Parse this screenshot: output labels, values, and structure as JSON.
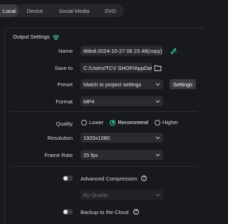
{
  "tabs": [
    {
      "label": "Local",
      "active": true
    },
    {
      "label": "Device",
      "active": false
    },
    {
      "label": "Social Media",
      "active": false
    },
    {
      "label": "DVD",
      "active": false
    }
  ],
  "section": {
    "title": "Output Settings",
    "icon": "crown-icon"
  },
  "form": {
    "name": {
      "label": "Name",
      "value": "ititled-2024-10-27 06 23 48(copy)"
    },
    "save_to": {
      "label": "Save to",
      "value": "C:/Users/TCV SHOP/AppData/"
    },
    "preset": {
      "label": "Preset",
      "value": "Match to project settings",
      "button": "Settings"
    },
    "format": {
      "label": "Format",
      "value": "MP4"
    },
    "quality": {
      "label": "Quality",
      "options": [
        "Lower",
        "Recommend",
        "Higher"
      ],
      "selected": "Recommend"
    },
    "resolution": {
      "label": "Resolution",
      "value": "1920x1080"
    },
    "frame_rate": {
      "label": "Frame Rate",
      "value": "25 fps"
    }
  },
  "advanced": {
    "label": "Advanced Compression",
    "enabled": false,
    "mode": "By Quality"
  },
  "cloud": {
    "label": "Backup to the Cloud",
    "enabled": false
  },
  "colors": {
    "accent": "#41d6b5",
    "background": "#18191c",
    "field": "#2a2b30"
  }
}
